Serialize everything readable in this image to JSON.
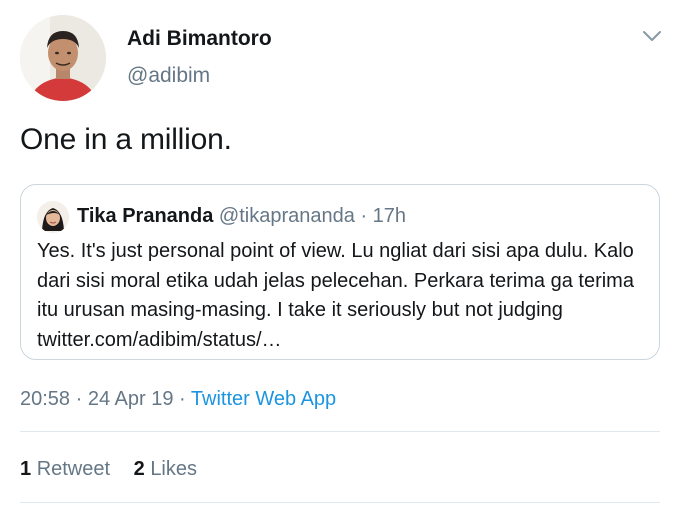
{
  "author": {
    "name": "Adi Bimantoro",
    "handle": "@adibim"
  },
  "tweet": {
    "text": "One in a million."
  },
  "quoted_tweet": {
    "name": "Tika Prananda",
    "handle": "@tikaprananda",
    "separator": "·",
    "time": "17h",
    "text": "Yes. It's just personal point of view. Lu ngliat dari sisi apa dulu. Kalo dari sisi moral etika udah jelas pelecehan. Perkara terima ga terima itu urusan masing-masing. I take it seriously but not judging twitter.com/adibim/status/…"
  },
  "meta": {
    "time": "20:58",
    "separator": "·",
    "date": "24 Apr 19",
    "app": "Twitter Web App"
  },
  "stats": {
    "retweets_count": "1",
    "retweets_label": "Retweet",
    "likes_count": "2",
    "likes_label": "Likes"
  },
  "colors": {
    "text_primary": "#14171a",
    "text_secondary": "#657786",
    "link": "#1b95e0",
    "border": "#ccd6dd"
  },
  "icons": {
    "menu": "chevron-down-icon"
  }
}
